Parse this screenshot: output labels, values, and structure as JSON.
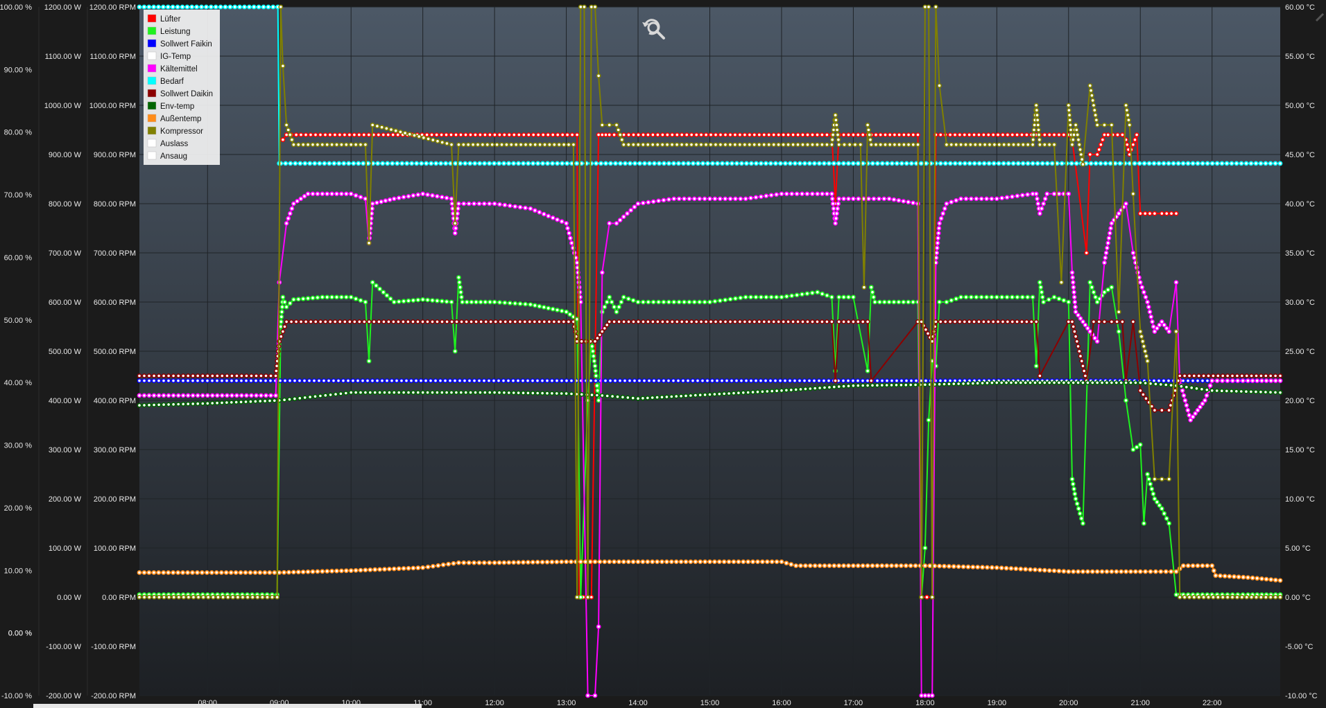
{
  "chart_data": {
    "type": "line",
    "x_unit": "hour",
    "x_ticks": [
      8,
      9,
      10,
      11,
      12,
      13,
      14,
      15,
      16,
      17,
      18,
      19,
      20,
      21,
      22
    ],
    "x_tick_labels": [
      "08:00",
      "09:00",
      "10:00",
      "11:00",
      "12:00",
      "13:00",
      "14:00",
      "15:00",
      "16:00",
      "17:00",
      "18:00",
      "19:00",
      "20:00",
      "21:00",
      "22:00"
    ],
    "xlim": [
      7.05,
      22.95
    ],
    "axes": {
      "percent": {
        "ylim": [
          -10,
          100
        ],
        "ticks": [
          100,
          90,
          80,
          70,
          60,
          50,
          40,
          30,
          20,
          10,
          0,
          0,
          -10
        ],
        "labels": [
          "100.00 %",
          "90.00 %",
          "80.00 %",
          "70.00 %",
          "60.00 %",
          "50.00 %",
          "40.00 %",
          "30.00 %",
          "20.00 %",
          "10.00 %",
          "0.00 %",
          "0.00 %",
          "-10.00 %"
        ]
      },
      "watt": {
        "ylim": [
          -200,
          1200
        ],
        "ticks": [
          1200,
          1100,
          1000,
          900,
          800,
          700,
          600,
          500,
          400,
          300,
          200,
          100,
          0,
          -100,
          -200
        ],
        "labels": [
          "1200.00 W",
          "1100.00 W",
          "1000.00 W",
          "900.00 W",
          "800.00 W",
          "700.00 W",
          "600.00 W",
          "500.00 W",
          "400.00 W",
          "300.00 W",
          "200.00 W",
          "100.00 W",
          "0.00 W",
          "-100.00 W",
          "-200.00 W"
        ]
      },
      "rpm": {
        "ylim": [
          -200,
          1200
        ],
        "ticks": [
          1200,
          1100,
          1000,
          900,
          800,
          700,
          600,
          500,
          400,
          300,
          200,
          100,
          0,
          -100,
          -200
        ],
        "labels": [
          "1200.00 RPM",
          "1100.00 RPM",
          "1000.00 RPM",
          "900.00 RPM",
          "800.00 RPM",
          "700.00 RPM",
          "600.00 RPM",
          "500.00 RPM",
          "400.00 RPM",
          "300.00 RPM",
          "200.00 RPM",
          "100.00 RPM",
          "0.00 RPM",
          "-100.00 RPM",
          "-200.00 RPM"
        ]
      },
      "celsius": {
        "ylim": [
          -10,
          60
        ],
        "ticks": [
          60,
          55,
          50,
          45,
          40,
          35,
          30,
          25,
          20,
          15,
          10,
          5,
          0,
          -5,
          -10
        ],
        "labels": [
          "60.00 °C",
          "55.00 °C",
          "50.00 °C",
          "45.00 °C",
          "40.00 °C",
          "35.00 °C",
          "30.00 °C",
          "25.00 °C",
          "20.00 °C",
          "15.00 °C",
          "10.00 °C",
          "5.00 °C",
          "0.00 °C",
          "-5.00 °C",
          "-10.00 °C"
        ]
      }
    },
    "grid": true,
    "legend_position": "top-left",
    "series": [
      {
        "name": "Lüfter",
        "color": "#ff0000",
        "axis": "rpm",
        "x": [
          7.05,
          9.0,
          9.05,
          9.1,
          13.15,
          13.18,
          13.35,
          13.45,
          13.5,
          13.55,
          13.6,
          16.7,
          16.75,
          16.8,
          17.2,
          17.25,
          17.9,
          17.95,
          18.1,
          18.15,
          19.55,
          19.6,
          20.0,
          20.05,
          20.25,
          20.3,
          20.4,
          20.5,
          20.55,
          20.75,
          20.8,
          20.85,
          20.95,
          21.0,
          21.2,
          21.3,
          21.5,
          21.55,
          22.95
        ],
        "y": [
          null,
          null,
          930,
          940,
          940,
          0,
          0,
          940,
          940,
          940,
          940,
          940,
          800,
          940,
          940,
          940,
          940,
          0,
          0,
          940,
          940,
          940,
          940,
          930,
          700,
          900,
          900,
          940,
          940,
          940,
          930,
          900,
          940,
          780,
          780,
          780,
          780,
          null,
          null
        ]
      },
      {
        "name": "Leistung",
        "color": "#1ff21f",
        "axis": "watt",
        "x": [
          7.05,
          8.0,
          8.9,
          8.97,
          9.02,
          9.05,
          9.1,
          9.2,
          9.6,
          10.0,
          10.2,
          10.25,
          10.3,
          10.6,
          11.0,
          11.4,
          11.45,
          11.5,
          11.55,
          12.0,
          12.5,
          13.0,
          13.15,
          13.2,
          13.3,
          13.35,
          13.4,
          13.45,
          13.5,
          13.6,
          13.7,
          13.8,
          14.0,
          14.5,
          15.0,
          15.5,
          16.0,
          16.5,
          16.7,
          16.75,
          16.8,
          17.0,
          17.2,
          17.25,
          17.3,
          17.5,
          17.9,
          17.95,
          18.0,
          18.05,
          18.1,
          18.15,
          18.2,
          18.3,
          18.5,
          19.0,
          19.5,
          19.55,
          19.6,
          19.65,
          19.8,
          20.0,
          20.05,
          20.1,
          20.2,
          20.3,
          20.4,
          20.5,
          20.6,
          20.7,
          20.8,
          20.9,
          21.0,
          21.05,
          21.1,
          21.2,
          21.3,
          21.4,
          21.5,
          21.55,
          21.6,
          22.0,
          22.5,
          22.95
        ],
        "y": [
          5,
          5,
          5,
          5,
          550,
          610,
          590,
          605,
          610,
          610,
          600,
          480,
          640,
          600,
          605,
          600,
          500,
          650,
          600,
          600,
          595,
          580,
          565,
          0,
          400,
          520,
          470,
          400,
          580,
          610,
          580,
          610,
          600,
          600,
          600,
          610,
          610,
          620,
          610,
          460,
          610,
          610,
          460,
          630,
          600,
          600,
          600,
          0,
          100,
          360,
          480,
          470,
          600,
          600,
          610,
          610,
          610,
          470,
          640,
          600,
          610,
          600,
          240,
          200,
          150,
          640,
          600,
          620,
          630,
          540,
          400,
          300,
          310,
          150,
          250,
          200,
          180,
          150,
          5,
          5,
          5,
          5,
          5,
          5
        ]
      },
      {
        "name": "Sollwert Faikin",
        "color": "#0000ff",
        "axis": "celsius",
        "x": [
          7.05,
          22.95
        ],
        "y": [
          22.0,
          22.0
        ]
      },
      {
        "name": "IG-Temp",
        "color": "#ffffff",
        "axis": "celsius",
        "x": [],
        "y": []
      },
      {
        "name": "Kältemittel",
        "color": "#ff00ff",
        "axis": "celsius",
        "x": [
          7.05,
          8.95,
          9.0,
          9.1,
          9.2,
          9.4,
          9.6,
          10.0,
          10.2,
          10.25,
          10.3,
          10.6,
          11.0,
          11.4,
          11.45,
          11.5,
          12.0,
          12.5,
          13.0,
          13.15,
          13.2,
          13.3,
          13.4,
          13.45,
          13.5,
          13.6,
          13.7,
          14.0,
          14.5,
          15.0,
          15.5,
          16.0,
          16.5,
          16.7,
          16.75,
          16.8,
          17.0,
          17.5,
          17.9,
          17.95,
          18.0,
          18.05,
          18.1,
          18.15,
          18.2,
          18.3,
          18.5,
          19.0,
          19.5,
          19.55,
          19.6,
          19.7,
          19.8,
          20.0,
          20.05,
          20.1,
          20.2,
          20.3,
          20.4,
          20.5,
          20.6,
          20.7,
          20.8,
          20.9,
          21.0,
          21.1,
          21.2,
          21.3,
          21.4,
          21.5,
          21.55,
          21.7,
          21.8,
          21.9,
          22.0,
          22.5,
          22.95
        ],
        "y": [
          20.5,
          20.5,
          32,
          38,
          40,
          41,
          41,
          41,
          40.5,
          36,
          40,
          40.5,
          41,
          40.5,
          37,
          40,
          40,
          39.5,
          38,
          34,
          30,
          -12,
          -12,
          -3,
          33,
          38,
          38,
          40,
          40.5,
          40.5,
          40.5,
          41,
          41,
          41,
          38,
          40.5,
          40.5,
          40.5,
          40,
          -10,
          -12,
          -12,
          -10,
          34,
          38,
          40,
          40.5,
          40.5,
          41,
          41,
          39,
          41,
          41,
          41,
          33,
          29,
          28,
          27,
          26,
          34,
          38,
          39,
          40,
          35,
          32,
          30,
          27,
          28,
          27,
          32,
          22,
          18,
          19,
          20,
          22,
          22,
          22
        ]
      },
      {
        "name": "Bedarf",
        "color": "#00ffff",
        "axis": "percent",
        "x": [
          7.05,
          8.98,
          9.0,
          9.02,
          22.95
        ],
        "y": [
          100,
          100,
          75,
          75,
          75
        ]
      },
      {
        "name": "Sollwert Daikin",
        "color": "#8b0000",
        "axis": "celsius",
        "x": [
          7.05,
          8.95,
          9.0,
          9.1,
          13.1,
          13.15,
          13.4,
          13.5,
          13.6,
          16.7,
          16.75,
          16.8,
          17.2,
          17.25,
          17.9,
          17.95,
          18.1,
          18.15,
          19.55,
          19.6,
          20.0,
          20.05,
          20.15,
          20.25,
          20.35,
          20.5,
          20.6,
          20.75,
          20.8,
          20.9,
          21.0,
          21.2,
          21.3,
          21.4,
          21.55,
          22.95
        ],
        "y": [
          22.5,
          22.5,
          26,
          28,
          28,
          26,
          26,
          27,
          28,
          28,
          22,
          28,
          28,
          22,
          28,
          28,
          26,
          28,
          28,
          22.5,
          28,
          28,
          25,
          22,
          28,
          28,
          28,
          28,
          22,
          28,
          21,
          19,
          19,
          19,
          22.5,
          22.5
        ]
      },
      {
        "name": "Env-temp",
        "color": "#006400",
        "axis": "celsius",
        "x": [
          7.05,
          8.0,
          9.0,
          9.5,
          10.0,
          11.0,
          12.0,
          13.0,
          13.5,
          14.0,
          15.0,
          16.0,
          17.0,
          18.0,
          19.0,
          20.0,
          21.0,
          21.5,
          22.0,
          22.95
        ],
        "y": [
          19.5,
          19.7,
          20.0,
          20.4,
          20.8,
          20.8,
          20.8,
          20.7,
          20.5,
          20.2,
          20.6,
          21.0,
          21.5,
          21.6,
          21.8,
          21.8,
          21.8,
          21.5,
          21.0,
          20.8
        ]
      },
      {
        "name": "Außentemp",
        "color": "#ff8c1a",
        "axis": "celsius",
        "x": [
          7.05,
          9.0,
          10.0,
          11.0,
          11.5,
          12.0,
          13.0,
          14.0,
          15.0,
          16.0,
          16.2,
          17.0,
          18.0,
          19.0,
          20.0,
          21.0,
          21.5,
          21.6,
          22.0,
          22.05,
          22.5,
          22.95
        ],
        "y": [
          2.5,
          2.5,
          2.7,
          3.0,
          3.5,
          3.5,
          3.6,
          3.6,
          3.6,
          3.6,
          3.2,
          3.2,
          3.2,
          3.0,
          2.6,
          2.6,
          2.6,
          3.2,
          3.2,
          2.2,
          2.0,
          1.7
        ]
      },
      {
        "name": "Kompressor",
        "color": "#808000",
        "axis": "rpm",
        "x": [
          7.05,
          8.97,
          9.02,
          9.05,
          9.1,
          9.2,
          10.2,
          10.25,
          10.3,
          11.4,
          11.45,
          11.5,
          13.1,
          13.15,
          13.2,
          13.25,
          13.3,
          13.35,
          13.4,
          13.45,
          13.5,
          13.6,
          13.7,
          13.8,
          16.7,
          16.75,
          16.8,
          17.1,
          17.15,
          17.2,
          17.25,
          17.9,
          17.95,
          18.0,
          18.05,
          18.1,
          18.15,
          18.2,
          18.3,
          19.5,
          19.55,
          19.6,
          19.8,
          19.9,
          20.0,
          20.05,
          20.1,
          20.2,
          20.3,
          20.4,
          20.5,
          20.6,
          20.7,
          20.8,
          20.85,
          20.9,
          21.0,
          21.1,
          21.2,
          21.3,
          21.4,
          21.5,
          21.55,
          22.95
        ],
        "y": [
          0,
          0,
          1200,
          1080,
          960,
          920,
          920,
          720,
          960,
          920,
          760,
          920,
          920,
          0,
          1200,
          1200,
          0,
          1200,
          1200,
          1060,
          960,
          960,
          960,
          920,
          920,
          980,
          920,
          920,
          630,
          960,
          920,
          920,
          0,
          1200,
          1200,
          0,
          1200,
          1040,
          920,
          920,
          1000,
          920,
          920,
          640,
          1000,
          920,
          960,
          880,
          1040,
          960,
          960,
          960,
          580,
          1000,
          960,
          820,
          540,
          480,
          240,
          240,
          240,
          540,
          0,
          0
        ]
      },
      {
        "name": "Auslass",
        "color": "#ffffff",
        "axis": "celsius",
        "x": [],
        "y": []
      },
      {
        "name": "Ansaug",
        "color": "#ffffff",
        "axis": "celsius",
        "x": [],
        "y": []
      }
    ]
  },
  "toolbar": {
    "reset_zoom_icon": "reset-zoom-icon"
  }
}
